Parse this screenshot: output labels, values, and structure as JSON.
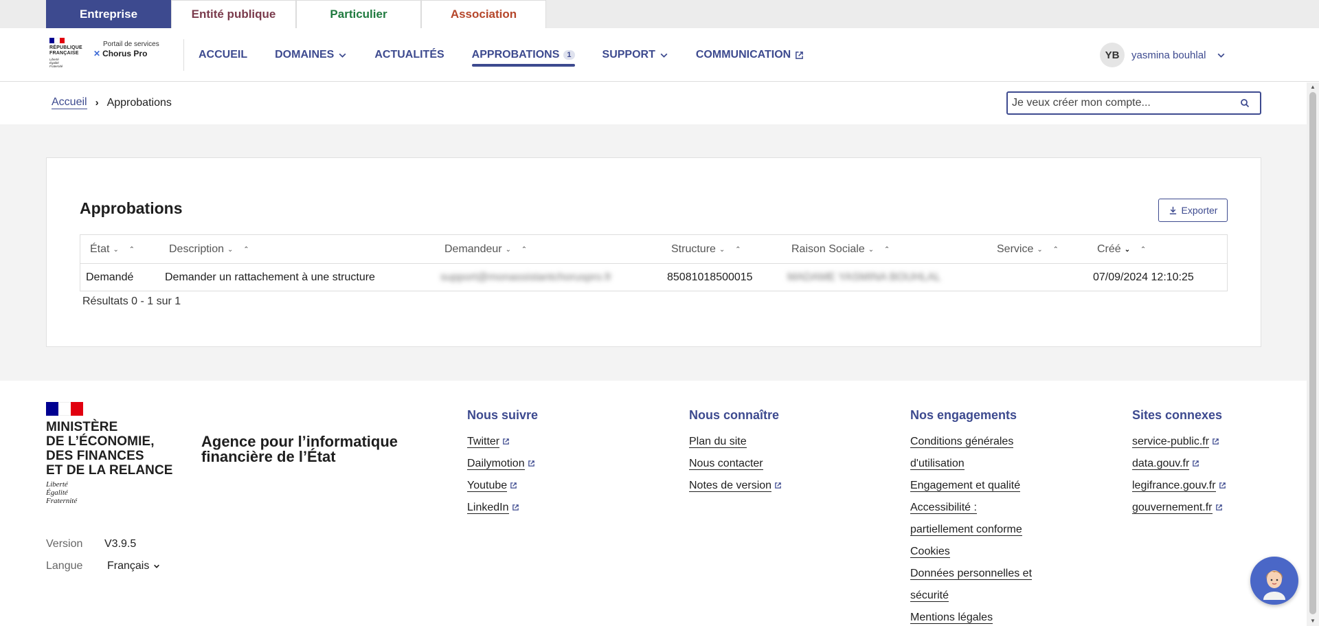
{
  "audience_tabs": [
    {
      "label": "Entreprise",
      "color": "#ffffff",
      "active": true
    },
    {
      "label": "Entité publique",
      "color": "#7a3b4c",
      "active": false
    },
    {
      "label": "Particulier",
      "color": "#1f7a3f",
      "active": false
    },
    {
      "label": "Association",
      "color": "#b5462a",
      "active": false
    }
  ],
  "branding": {
    "republic_line1": "RÉPUBLIQUE",
    "republic_line2": "FRANÇAISE",
    "motto1": "Liberté",
    "motto2": "Égalité",
    "motto3": "Fraternité",
    "portal_label": "Portail de services",
    "product_name": "Chorus Pro"
  },
  "nav": {
    "accueil": "ACCUEIL",
    "domaines": "DOMAINES",
    "actualites": "ACTUALITÉS",
    "approbations": "APPROBATIONS",
    "approbations_count": "1",
    "support": "SUPPORT",
    "communication": "COMMUNICATION"
  },
  "user": {
    "initials": "YB",
    "name": "yasmina bouhlal"
  },
  "breadcrumb": {
    "home": "Accueil",
    "current": "Approbations"
  },
  "search": {
    "placeholder": "Je veux créer mon compte..."
  },
  "page": {
    "title": "Approbations",
    "export_label": "Exporter",
    "results": "Résultats 0 - 1 sur 1"
  },
  "table": {
    "headers": [
      "État",
      "Description",
      "Demandeur",
      "Structure",
      "Raison Sociale",
      "Service",
      "Créé"
    ],
    "rows": [
      {
        "etat": "Demandé",
        "description": "Demander un rattachement à une structure",
        "demandeur": "support@monassistantchoruspro.fr",
        "structure": "85081018500015",
        "raison_sociale": "MADAME YASMINA BOUHLAL",
        "service": "",
        "cree": "07/09/2024 12:10:25"
      }
    ]
  },
  "footer": {
    "ministry_lines": [
      "MINISTÈRE",
      "DE L’ÉCONOMIE,",
      "DES FINANCES",
      "ET DE LA RELANCE"
    ],
    "ministry_motto": [
      "Liberté",
      "Égalité",
      "Fraternité"
    ],
    "agency_lines": [
      "Agence pour l’informatique",
      "financière de l’État"
    ],
    "version_label": "Version",
    "version_value": "V3.9.5",
    "language_label": "Langue",
    "language_value": "Français",
    "columns": [
      {
        "title": "Nous suivre",
        "links": [
          {
            "label": "Twitter",
            "external": true
          },
          {
            "label": "Dailymotion",
            "external": true
          },
          {
            "label": "Youtube",
            "external": true
          },
          {
            "label": "LinkedIn",
            "external": true
          }
        ]
      },
      {
        "title": "Nous connaître",
        "links": [
          {
            "label": "Plan du site",
            "external": false
          },
          {
            "label": "Nous contacter",
            "external": false
          },
          {
            "label": "Notes de version",
            "external": true
          }
        ]
      },
      {
        "title": "Nos engagements",
        "links": [
          {
            "label": "Conditions générales",
            "external": false
          },
          {
            "label": "d'utilisation",
            "external": false
          },
          {
            "label": "Engagement et qualité",
            "external": false
          },
          {
            "label": "Accessibilité :",
            "external": false
          },
          {
            "label": "partiellement conforme",
            "external": false
          },
          {
            "label": "Cookies",
            "external": false
          },
          {
            "label": "Données personnelles et",
            "external": false
          },
          {
            "label": "sécurité",
            "external": false
          },
          {
            "label": "Mentions légales",
            "external": false
          }
        ]
      },
      {
        "title": "Sites connexes",
        "links": [
          {
            "label": "service-public.fr",
            "external": true
          },
          {
            "label": "data.gouv.fr",
            "external": true
          },
          {
            "label": "legifrance.gouv.fr",
            "external": true
          },
          {
            "label": "gouvernement.fr",
            "external": true
          }
        ]
      }
    ]
  },
  "colors": {
    "primary": "#3d4a8f",
    "flag_blue": "#000091",
    "flag_red": "#e1000f"
  },
  "icons": {
    "search": "search-icon",
    "export": "download-icon",
    "external": "external-link-icon",
    "chevron": "chevron-down-icon",
    "chat": "chat-assistant-icon"
  }
}
